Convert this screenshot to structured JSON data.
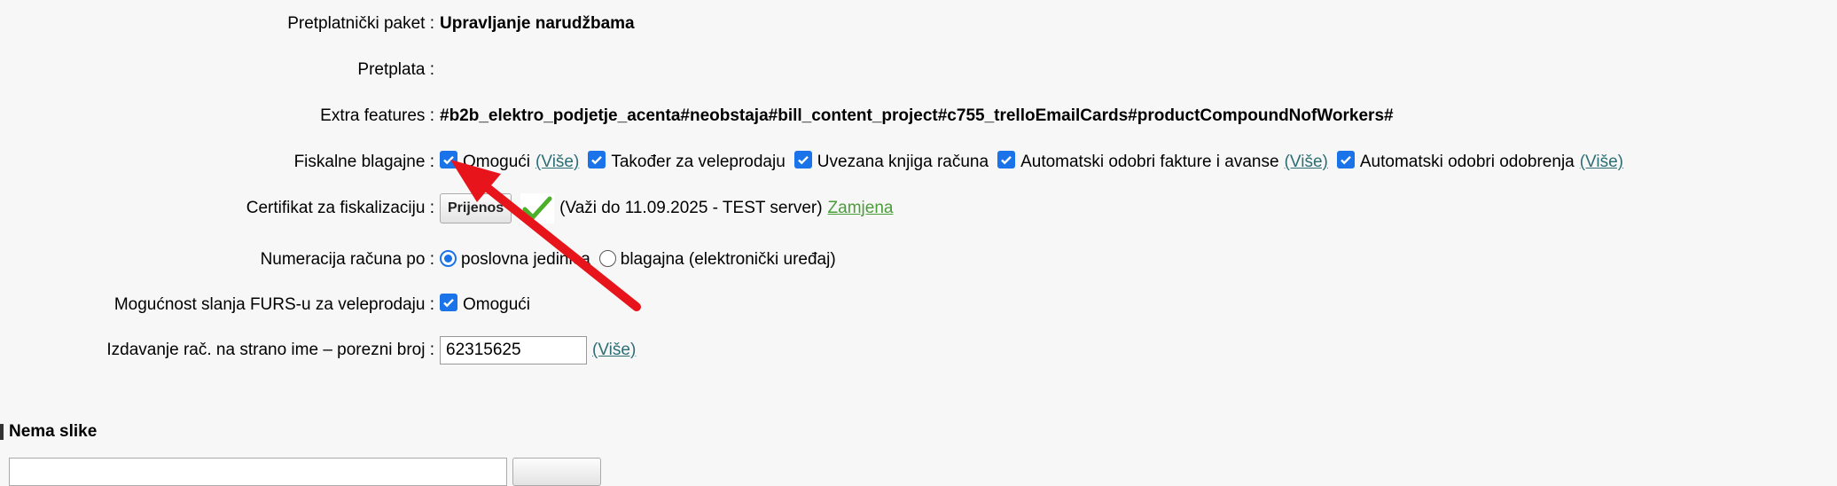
{
  "rows": {
    "package": {
      "label": "Pretplatnički paket :",
      "value": "Upravljanje narudžbama"
    },
    "subscription": {
      "label": "Pretplata :",
      "value": ""
    },
    "extra": {
      "label": "Extra features :",
      "value": "#b2b_elektro_podjetje_acenta#neobstaja#bill_content_project#c755_trelloEmailCards#productCompoundNofWorkers#"
    },
    "fiscal": {
      "label": "Fiskalne blagajne :",
      "options": [
        {
          "text": "Omogući",
          "checked": true,
          "link": "(Više)"
        },
        {
          "text": "Također za veleprodaju",
          "checked": true,
          "link": ""
        },
        {
          "text": "Uvezana knjiga računa",
          "checked": true,
          "link": ""
        },
        {
          "text": "Automatski odobri fakture i avanse",
          "checked": true,
          "link": "(Više)"
        },
        {
          "text": "Automatski odobri odobrenja",
          "checked": true,
          "link": "(Više)"
        }
      ]
    },
    "cert": {
      "label": "Certifikat za fiskalizaciju :",
      "button": "Prijenos",
      "info": "(Važi do 11.09.2025 - TEST server)",
      "link": "Zamjena"
    },
    "numbering": {
      "label": "Numeracija računa po :",
      "options": [
        {
          "text": "poslovna jedinica",
          "selected": true
        },
        {
          "text": "blagajna (elektronički uređaj)",
          "selected": false
        }
      ]
    },
    "furs": {
      "label": "Mogućnost slanja FURS-u za veleprodaju :",
      "option": "Omogući",
      "checked": true
    },
    "foreign": {
      "label": "Izdavanje rač. na strano ime – porezni broj :",
      "value": "62315625",
      "link": "(Više)"
    }
  },
  "bottom": {
    "title": "Nema slike"
  },
  "colors": {
    "checkbox": "#1a73e8",
    "link": "#2c6e74",
    "green_link": "#4a9e3a",
    "arrow": "#e8141b"
  },
  "icons": {
    "checkmark": "green-checkmark-icon",
    "arrow": "red-arrow-annotation"
  }
}
